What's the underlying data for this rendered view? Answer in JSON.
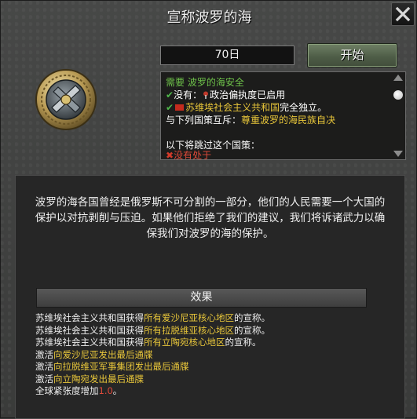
{
  "window": {
    "title": "宣称波罗的海"
  },
  "controls": {
    "days": "70日",
    "start_label": "开始"
  },
  "requirements": {
    "header": "需要 波罗的海安全",
    "line1_prefix": "没有：",
    "line1_value": "政治偏执度已启用",
    "line2_country": "苏维埃社会主义共和国",
    "line2_suffix": "完全独立。",
    "exclusive_prefix": "与下列国策互斥：",
    "exclusive_value": "尊重波罗的海民族自决",
    "bypass_label": "以下将跳过这个国策：",
    "bypass_partial": "没有处于"
  },
  "description": "波罗的海各国曾经是俄罗斯不可分割的一部分，他们的人民需要一个大国的保护以对抗剥削与压迫。如果他们拒绝了我们的建议，我们将诉诸武力以确保我们对波罗的海的保护。",
  "effects": {
    "header": "效果",
    "lines": [
      {
        "prefix": "苏维埃社会主义共和国获得",
        "highlight": "所有爱沙尼亚核心地区",
        "suffix": "的宣称。"
      },
      {
        "prefix": "苏维埃社会主义共和国获得",
        "highlight": "所有拉脱维亚核心地区",
        "suffix": "的宣称。"
      },
      {
        "prefix": "苏维埃社会主义共和国获得",
        "highlight": "所有立陶宛核心地区",
        "suffix": "的宣称。"
      },
      {
        "prefix": "激活",
        "highlight": "向爱沙尼亚发出最后通牒",
        "suffix": ""
      },
      {
        "prefix": "激活",
        "highlight": "向拉脱维亚军事集团发出最后通牒",
        "suffix": ""
      },
      {
        "prefix": "激活",
        "highlight": "向立陶宛发出最后通牒",
        "suffix": ""
      }
    ],
    "tension_prefix": "全球紧张度增加",
    "tension_value": "1.0",
    "tension_suffix": "。"
  },
  "colors": {
    "requirement_green": "#6ec24a",
    "highlight_yellow": "#e8c63a",
    "value_red": "#e04a3a",
    "start_button": "#5a6b52"
  },
  "icons": {
    "close": "close-icon",
    "emblem": "baltic-claim-emblem-icon",
    "check": "check-icon"
  }
}
